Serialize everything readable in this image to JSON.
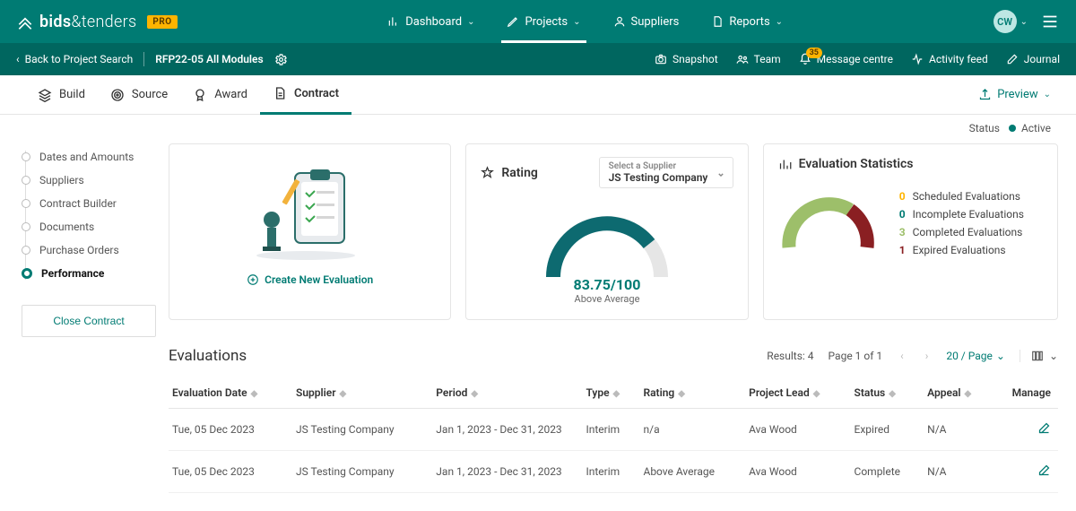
{
  "brand": {
    "part1": "bids",
    "part2": "&tenders",
    "badge": "PRO"
  },
  "mainmenu": [
    {
      "label": "Dashboard",
      "dropdown": true
    },
    {
      "label": "Projects",
      "dropdown": true,
      "active": true
    },
    {
      "label": "Suppliers",
      "dropdown": false
    },
    {
      "label": "Reports",
      "dropdown": true
    }
  ],
  "user_initials": "CW",
  "subbar": {
    "back_label": "Back to Project Search",
    "project_ref": "RFP22-05 All Modules"
  },
  "subnav": {
    "snapshot": "Snapshot",
    "team": "Team",
    "messages": "Message centre",
    "messages_badge": "35",
    "activity": "Activity feed",
    "journal": "Journal"
  },
  "tabs": [
    {
      "label": "Build"
    },
    {
      "label": "Source"
    },
    {
      "label": "Award"
    },
    {
      "label": "Contract",
      "active": true
    }
  ],
  "preview_label": "Preview",
  "status": {
    "label": "Status",
    "value": "Active"
  },
  "sidenav": {
    "items": [
      "Dates and Amounts",
      "Suppliers",
      "Contract Builder",
      "Documents",
      "Purchase Orders",
      "Performance"
    ],
    "active_index": 5,
    "close_label": "Close Contract"
  },
  "create_card": {
    "action": "Create New Evaluation"
  },
  "rating_card": {
    "title": "Rating",
    "picker_label": "Select a Supplier",
    "picker_value": "JS Testing Company",
    "score": "83.75/100",
    "score_label": "Above Average"
  },
  "stats_card": {
    "title": "Evaluation Statistics",
    "legend": [
      {
        "n": "0",
        "label": "Scheduled Evaluations",
        "color": "#ffb400"
      },
      {
        "n": "0",
        "label": "Incomplete Evaluations",
        "color": "#007b73"
      },
      {
        "n": "3",
        "label": "Completed Evaluations",
        "color": "#9dbf6a"
      },
      {
        "n": "1",
        "label": "Expired Evaluations",
        "color": "#8a1f22"
      }
    ]
  },
  "evaluations": {
    "title": "Evaluations",
    "results_label": "Results:",
    "results_count": "4",
    "page_label": "Page 1 of 1",
    "per_page": "20 / Page",
    "columns": [
      "Evaluation Date",
      "Supplier",
      "Period",
      "Type",
      "Rating",
      "Project Lead",
      "Status",
      "Appeal",
      "Manage"
    ],
    "rows": [
      {
        "date": "Tue, 05 Dec 2023",
        "supplier": "JS Testing Company",
        "period": "Jan 1, 2023 - Dec 31, 2023",
        "type": "Interim",
        "rating": "n/a",
        "lead": "Ava Wood",
        "status": "Expired",
        "appeal": "N/A"
      },
      {
        "date": "Tue, 05 Dec 2023",
        "supplier": "JS Testing Company",
        "period": "Jan 1, 2023 - Dec 31, 2023",
        "type": "Interim",
        "rating": "Above Average",
        "lead": "Ava Wood",
        "status": "Complete",
        "appeal": "N/A"
      }
    ]
  }
}
